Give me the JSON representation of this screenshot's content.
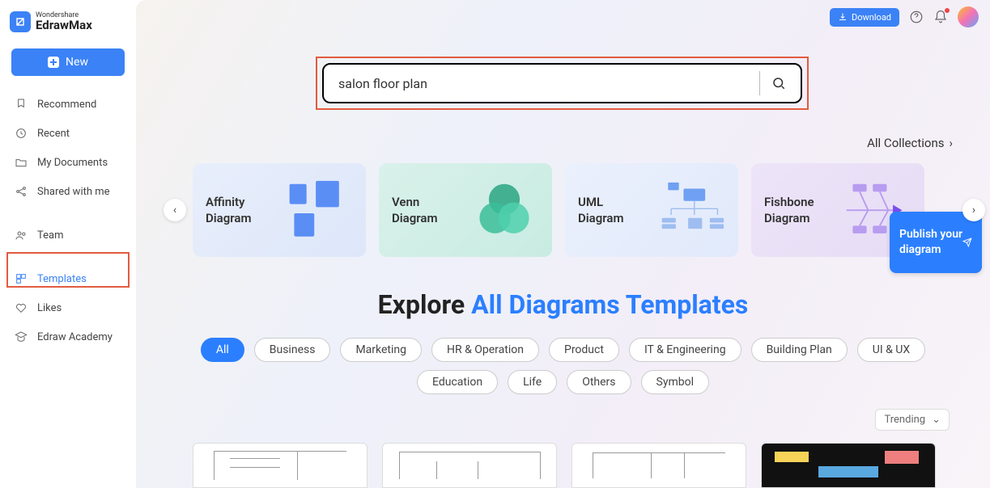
{
  "brand": {
    "top": "Wondershare",
    "bottom": "EdrawMax"
  },
  "sidebar": {
    "new_label": "New",
    "items": [
      {
        "label": "Recommend"
      },
      {
        "label": "Recent"
      },
      {
        "label": "My Documents"
      },
      {
        "label": "Shared with me"
      },
      {
        "label": "Team"
      },
      {
        "label": "Templates"
      },
      {
        "label": "Likes"
      },
      {
        "label": "Edraw Academy"
      }
    ]
  },
  "header": {
    "download_label": "Download"
  },
  "search": {
    "value": "salon floor plan"
  },
  "all_collections_label": "All Collections",
  "carousel": [
    {
      "title": "Affinity Diagram"
    },
    {
      "title": "Venn Diagram"
    },
    {
      "title": "UML Diagram"
    },
    {
      "title": "Fishbone Diagram"
    }
  ],
  "publish": {
    "text": "Publish your diagram"
  },
  "explore": {
    "prefix": "Explore ",
    "highlight": "All Diagrams Templates"
  },
  "filters_row1": [
    "All",
    "Business",
    "Marketing",
    "HR & Operation",
    "Product",
    "IT & Engineering",
    "Building Plan",
    "UI & UX"
  ],
  "filters_row2": [
    "Education",
    "Life",
    "Others",
    "Symbol"
  ],
  "sort": {
    "label": "Trending"
  }
}
